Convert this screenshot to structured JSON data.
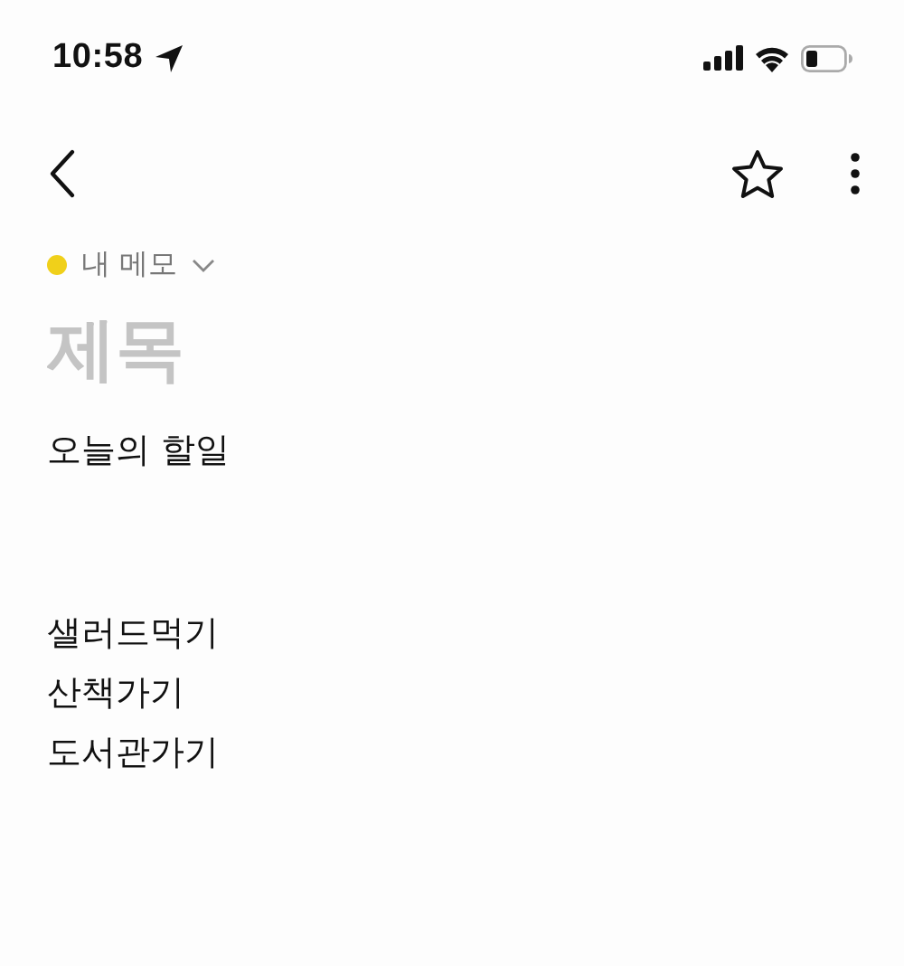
{
  "status_bar": {
    "time": "10:58"
  },
  "folder": {
    "label": "내 메모"
  },
  "title_field": {
    "placeholder": "제목"
  },
  "body": {
    "paragraphs": [
      [
        "오늘의 할일"
      ],
      [
        "샐러드먹기",
        "산책가기",
        "도서관가기"
      ]
    ]
  }
}
